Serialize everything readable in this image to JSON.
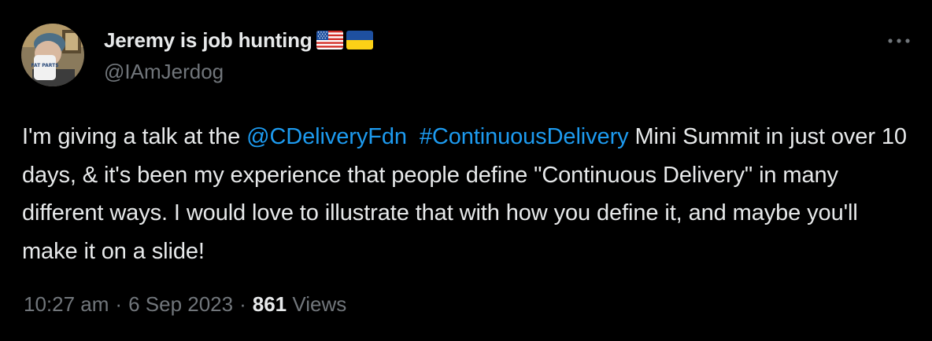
{
  "author": {
    "display_name": "Jeremy is job hunting",
    "handle": "@IAmJerdog",
    "flags": [
      "us-flag-icon",
      "ukraine-flag-icon"
    ],
    "avatar_mug_text": "FAT PARTS"
  },
  "tweet": {
    "segments": [
      {
        "text": "I'm giving a talk at the ",
        "type": "text"
      },
      {
        "text": "@CDeliveryFdn",
        "type": "mention"
      },
      {
        "text": "  ",
        "type": "text"
      },
      {
        "text": "#ContinuousDelivery",
        "type": "hashtag"
      },
      {
        "text": " Mini Summit in just over 10 days, & it's been my experience that people define \"Continuous Delivery\" in many different ways. I would love to illustrate that with how you define it, and maybe you'll make it on a slide!",
        "type": "text"
      }
    ]
  },
  "meta": {
    "time": "10:27 am",
    "date": "6 Sep 2023",
    "separator": "·",
    "views_count": "861",
    "views_label": "Views"
  },
  "colors": {
    "background": "#000000",
    "text": "#e7e9ea",
    "secondary": "#71767b",
    "link": "#1d9bf0"
  },
  "icons": {
    "more": "more-options-icon"
  }
}
